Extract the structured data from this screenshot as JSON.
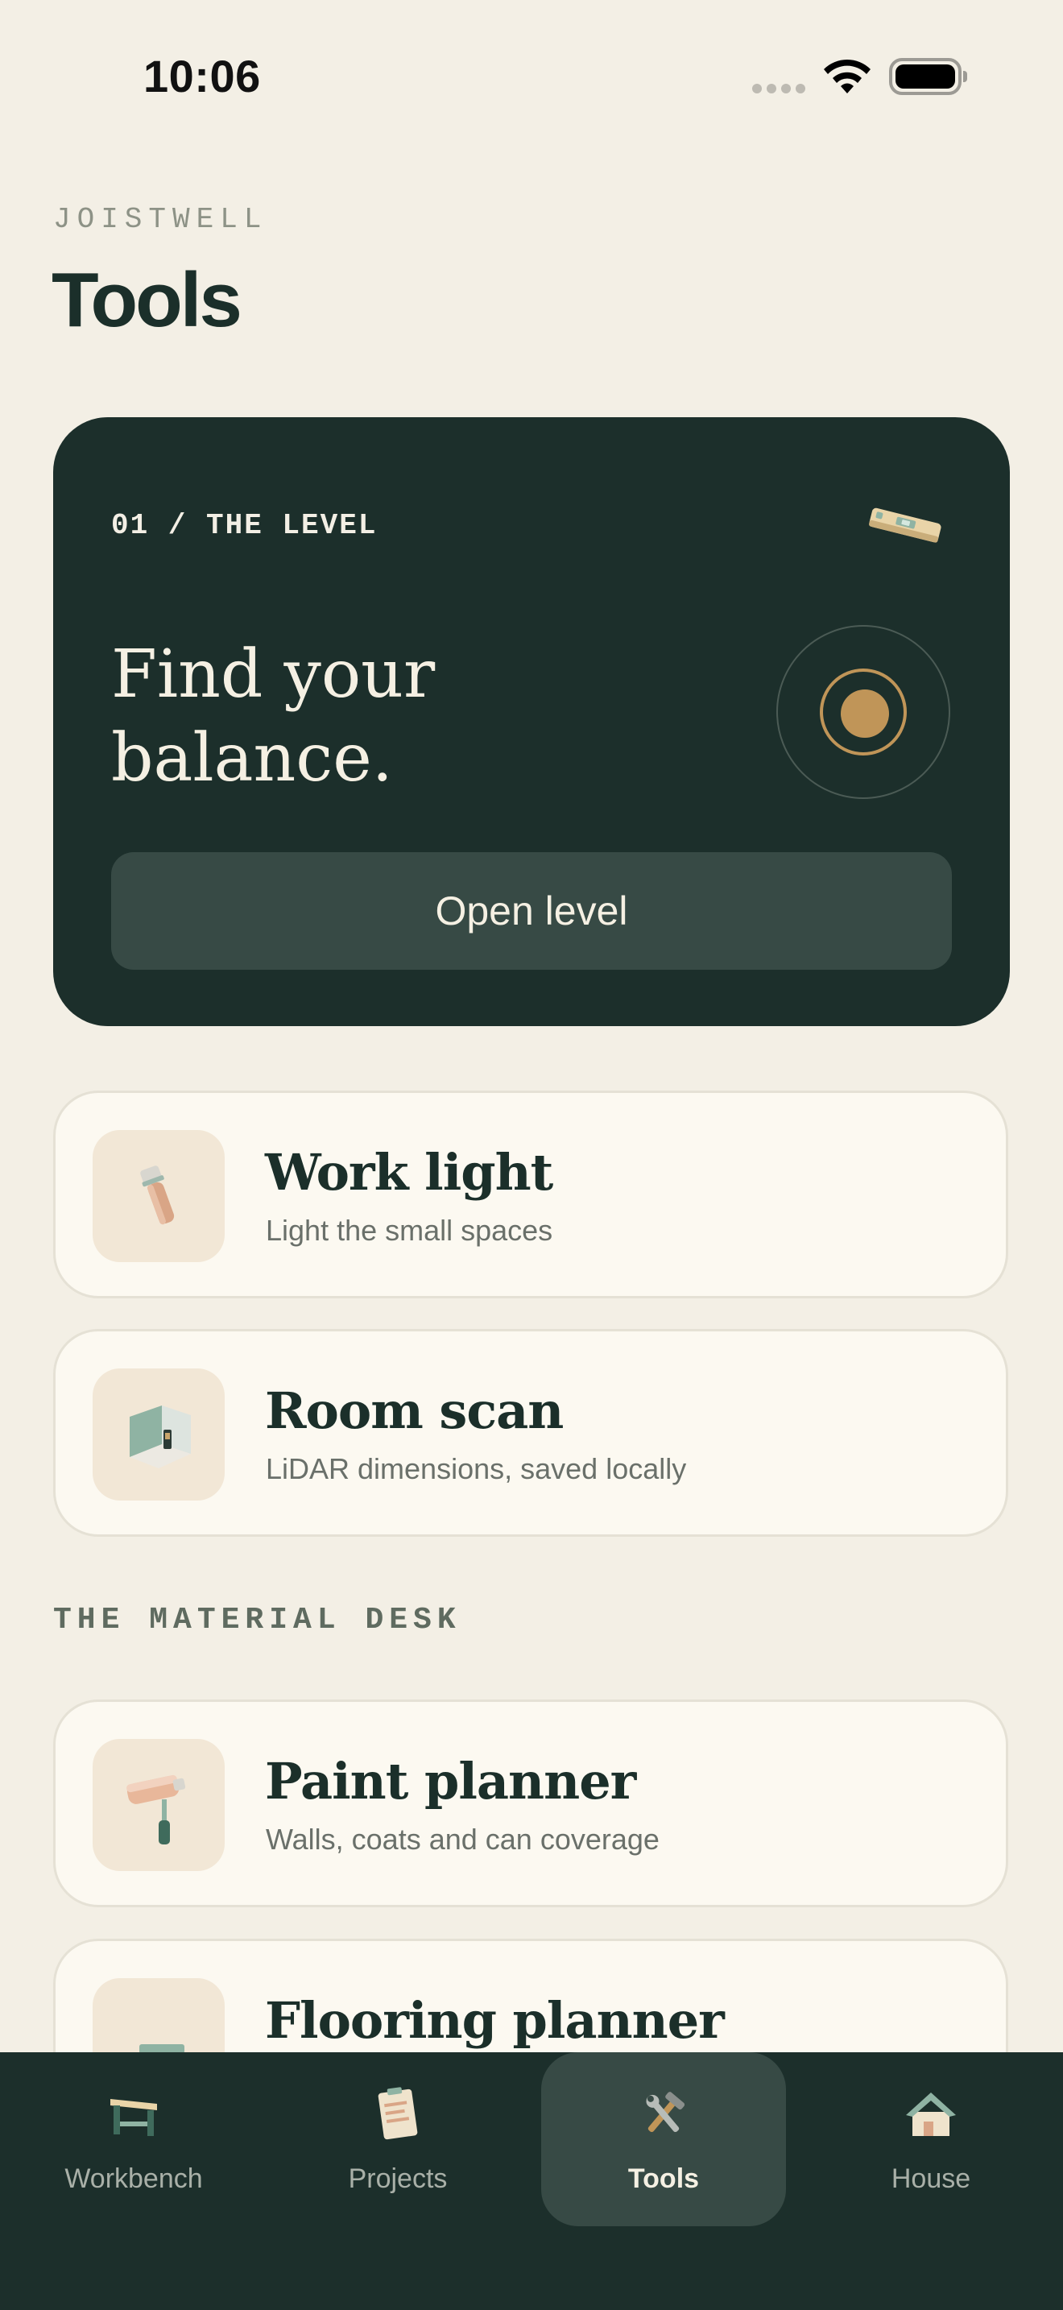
{
  "status_bar": {
    "time": "10:06"
  },
  "header": {
    "brand": "JOISTWELL",
    "title": "Tools"
  },
  "hero": {
    "kicker": "01 / THE LEVEL",
    "headline_line1": "Find your",
    "headline_line2": "balance.",
    "button_label": "Open level",
    "icon": "spirit-level-icon"
  },
  "tools": [
    {
      "title": "Work light",
      "subtitle": "Light the small spaces",
      "icon": "flashlight-icon"
    },
    {
      "title": "Room scan",
      "subtitle": "LiDAR dimensions, saved locally",
      "icon": "room-scan-icon"
    },
    {
      "title": "Paint planner",
      "subtitle": "Walls, coats and can coverage",
      "icon": "paint-roller-icon"
    },
    {
      "title": "Flooring planner",
      "subtitle": "",
      "icon": "flooring-planks-icon"
    }
  ],
  "section": {
    "material_desk": "THE MATERIAL DESK"
  },
  "tab_bar": {
    "tabs": [
      {
        "label": "Workbench",
        "icon": "workbench-icon",
        "active": false
      },
      {
        "label": "Projects",
        "icon": "clipboard-icon",
        "active": false
      },
      {
        "label": "Tools",
        "icon": "tools-icon",
        "active": true
      },
      {
        "label": "House",
        "icon": "house-icon",
        "active": false
      }
    ]
  },
  "colors": {
    "background": "#f3efe5",
    "dark_green": "#1c2f2b",
    "accent_gold": "#c09558",
    "card": "#fcf9f1"
  }
}
